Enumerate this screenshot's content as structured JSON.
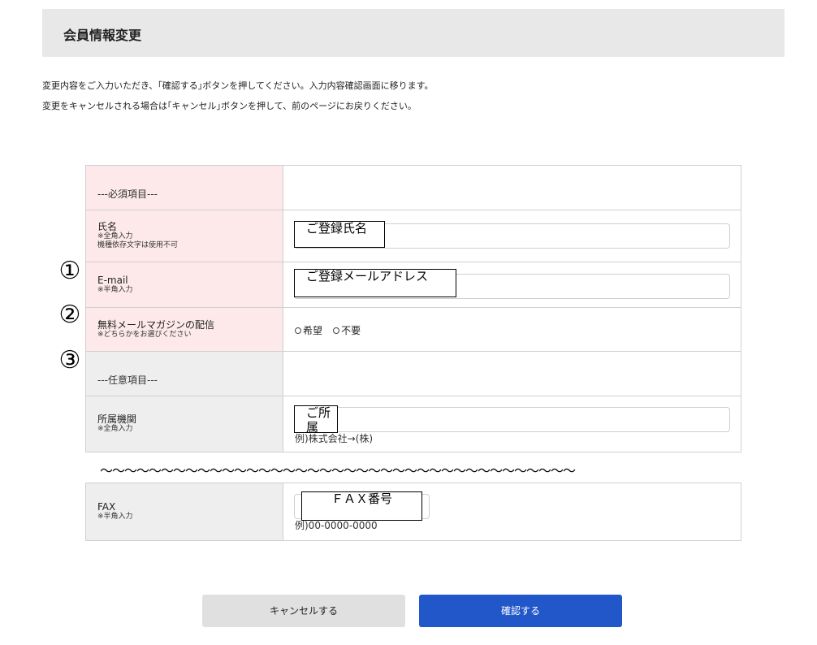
{
  "page": {
    "title": "会員情報変更",
    "intro_line1": "変更内容をご入力いただき、｢確認する｣ボタンを押してください。入力内容確認画面に移ります。",
    "intro_line2": "変更をキャンセルされる場合は｢キャンセル｣ボタンを押して、前のページにお戻りください。"
  },
  "form": {
    "required_header": "---必須項目---",
    "optional_header": "---任意項目---",
    "name": {
      "label": "氏名",
      "note1": "※全角入力",
      "note2": "機種依存文字は使用不可",
      "value": "ご登録氏名"
    },
    "email": {
      "label": "E-mail",
      "note": "※半角入力",
      "value": "ご登録メールアドレス"
    },
    "newsletter": {
      "label": "無料メールマガジンの配信",
      "note": "※どちらかをお選びください",
      "options": [
        "希望",
        "不要"
      ]
    },
    "affiliation": {
      "label": "所属機関",
      "note": "※全角入力",
      "value": "ご所属",
      "example": "例)株式会社→(株)"
    },
    "fax": {
      "label": "FAX",
      "note": "※半角入力",
      "value": "ＦＡＸ番号",
      "example": "例)00-0000-0000"
    }
  },
  "annotations": {
    "marker1": "①",
    "marker2": "②",
    "marker3": "③"
  },
  "omission_wave": "～～～～～～～～～～～～～～～～～～～～～～～～～～～～～～～～～～～～～～～",
  "buttons": {
    "cancel": "キャンセルする",
    "confirm": "確認する"
  },
  "colors": {
    "accent": "#2257c9",
    "required_bg": "#fde9e9",
    "optional_bg": "#eeeeee"
  }
}
